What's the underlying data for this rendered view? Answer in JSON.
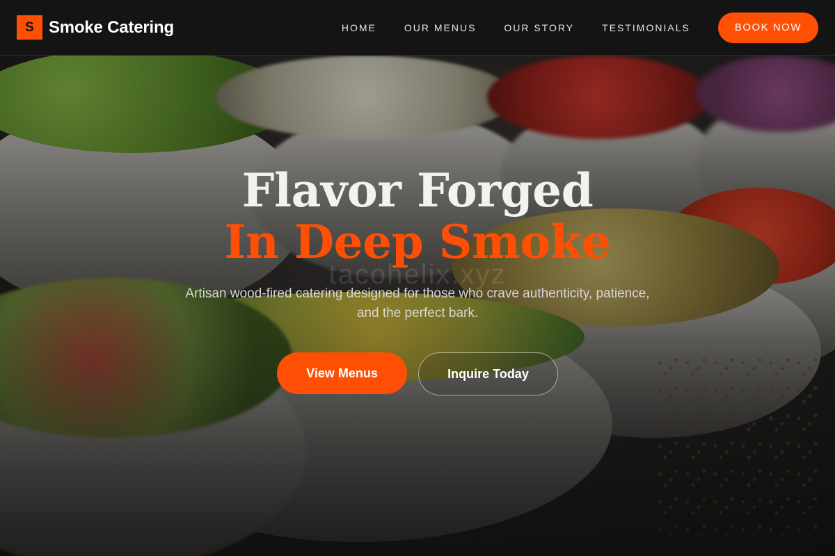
{
  "brand": {
    "logo_letter": "S",
    "name": "Smoke Catering",
    "accent": "#ff4f04"
  },
  "nav": {
    "links": [
      {
        "label": "HOME"
      },
      {
        "label": "OUR MENUS"
      },
      {
        "label": "OUR STORY"
      },
      {
        "label": "TESTIMONIALS"
      }
    ],
    "book_label": "BOOK NOW"
  },
  "hero": {
    "headline_line1": "Flavor Forged",
    "headline_line2": "In Deep Smoke",
    "watermark": "tacohelix.xyz",
    "subtitle": "Artisan wood-fired catering designed for those who crave authenticity, patience, and the perfect bark.",
    "primary_cta": "View Menus",
    "secondary_cta": "Inquire Today",
    "background_image": "food-bowls-photo"
  }
}
